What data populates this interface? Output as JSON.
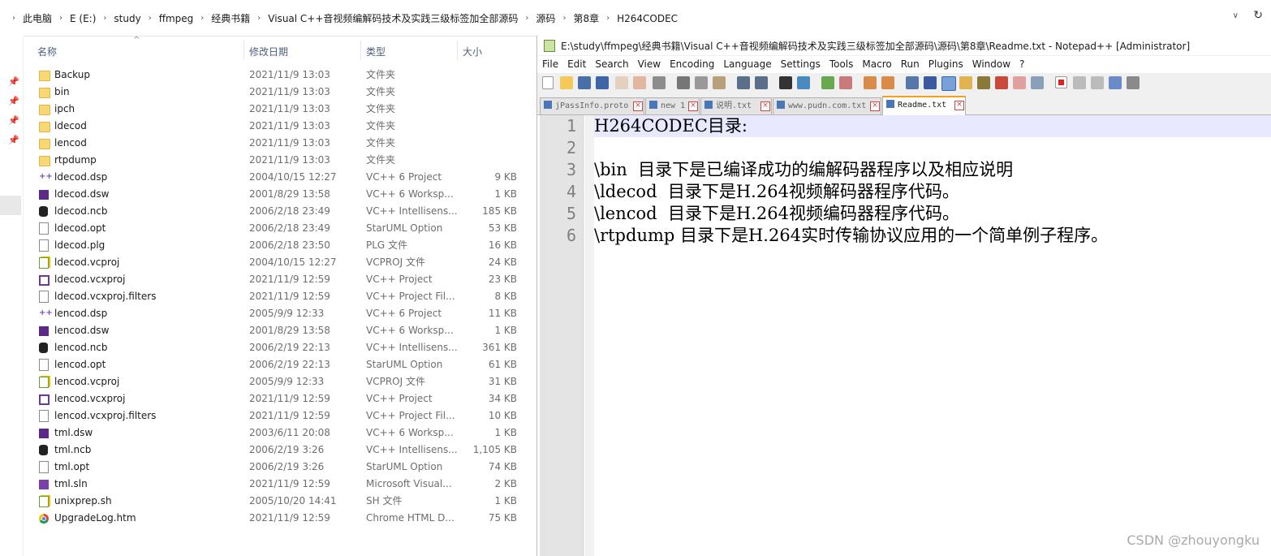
{
  "address_bar": {
    "crumbs": [
      "此电脑",
      "E (E:)",
      "study",
      "ffmpeg",
      "经典书籍",
      "Visual C++音视频编解码技术及实践三级标签加全部源码",
      "源码",
      "第8章",
      "H264CODEC"
    ]
  },
  "columns": {
    "name": "名称",
    "date": "修改日期",
    "type": "类型",
    "size": "大小"
  },
  "files": [
    {
      "icon": "folder-icon",
      "name": "Backup",
      "date": "2021/11/9 13:03",
      "type": "文件夹",
      "size": ""
    },
    {
      "icon": "folder-icon",
      "name": "bin",
      "date": "2021/11/9 13:03",
      "type": "文件夹",
      "size": ""
    },
    {
      "icon": "folder-icon",
      "name": "ipch",
      "date": "2021/11/9 13:03",
      "type": "文件夹",
      "size": ""
    },
    {
      "icon": "folder-icon",
      "name": "ldecod",
      "date": "2021/11/9 13:03",
      "type": "文件夹",
      "size": ""
    },
    {
      "icon": "folder-icon",
      "name": "lencod",
      "date": "2021/11/9 13:03",
      "type": "文件夹",
      "size": ""
    },
    {
      "icon": "folder-icon",
      "name": "rtpdump",
      "date": "2021/11/9 13:03",
      "type": "文件夹",
      "size": ""
    },
    {
      "icon": "cpp-project-icon",
      "name": "ldecod.dsp",
      "date": "2004/10/15 12:27",
      "type": "VC++ 6 Project",
      "size": "9 KB"
    },
    {
      "icon": "vs-workspace-icon",
      "name": "ldecod.dsw",
      "date": "2001/8/29 13:58",
      "type": "VC++ 6 Worksp...",
      "size": "1 KB"
    },
    {
      "icon": "database-icon",
      "name": "ldecod.ncb",
      "date": "2006/2/18 23:49",
      "type": "VC++ Intellisens...",
      "size": "185 KB"
    },
    {
      "icon": "document-icon",
      "name": "ldecod.opt",
      "date": "2006/2/18 23:49",
      "type": "StarUML Option",
      "size": "53 KB"
    },
    {
      "icon": "document-icon",
      "name": "ldecod.plg",
      "date": "2006/2/18 23:50",
      "type": "PLG 文件",
      "size": "16 KB"
    },
    {
      "icon": "edit-document-icon",
      "name": "ldecod.vcproj",
      "date": "2004/10/15 12:27",
      "type": "VCPROJ 文件",
      "size": "24 KB"
    },
    {
      "icon": "vs-project-icon",
      "name": "ldecod.vcxproj",
      "date": "2021/11/9 12:59",
      "type": "VC++ Project",
      "size": "23 KB"
    },
    {
      "icon": "document-icon",
      "name": "ldecod.vcxproj.filters",
      "date": "2021/11/9 12:59",
      "type": "VC++ Project Fil...",
      "size": "8 KB"
    },
    {
      "icon": "cpp-project-icon",
      "name": "lencod.dsp",
      "date": "2005/9/9 12:33",
      "type": "VC++ 6 Project",
      "size": "11 KB"
    },
    {
      "icon": "vs-workspace-icon",
      "name": "lencod.dsw",
      "date": "2001/8/29 13:58",
      "type": "VC++ 6 Worksp...",
      "size": "1 KB"
    },
    {
      "icon": "database-icon",
      "name": "lencod.ncb",
      "date": "2006/2/19 22:13",
      "type": "VC++ Intellisens...",
      "size": "361 KB"
    },
    {
      "icon": "document-icon",
      "name": "lencod.opt",
      "date": "2006/2/19 22:13",
      "type": "StarUML Option",
      "size": "61 KB"
    },
    {
      "icon": "edit-document-icon",
      "name": "lencod.vcproj",
      "date": "2005/9/9 12:33",
      "type": "VCPROJ 文件",
      "size": "31 KB"
    },
    {
      "icon": "vs-project-icon",
      "name": "lencod.vcxproj",
      "date": "2021/11/9 12:59",
      "type": "VC++ Project",
      "size": "34 KB"
    },
    {
      "icon": "document-icon",
      "name": "lencod.vcxproj.filters",
      "date": "2021/11/9 12:59",
      "type": "VC++ Project Fil...",
      "size": "10 KB"
    },
    {
      "icon": "vs-workspace-icon",
      "name": "tml.dsw",
      "date": "2003/6/11 20:08",
      "type": "VC++ 6 Worksp...",
      "size": "1 KB"
    },
    {
      "icon": "database-icon",
      "name": "tml.ncb",
      "date": "2006/2/19 3:26",
      "type": "VC++ Intellisens...",
      "size": "1,105 KB"
    },
    {
      "icon": "document-icon",
      "name": "tml.opt",
      "date": "2006/2/19 3:26",
      "type": "StarUML Option",
      "size": "74 KB"
    },
    {
      "icon": "vs-solution-icon",
      "name": "tml.sln",
      "date": "2021/11/9 12:59",
      "type": "Microsoft Visual...",
      "size": "2 KB"
    },
    {
      "icon": "edit-document-icon",
      "name": "unixprep.sh",
      "date": "2005/10/20 14:41",
      "type": "SH 文件",
      "size": "1 KB"
    },
    {
      "icon": "chrome-icon",
      "name": "UpgradeLog.htm",
      "date": "2021/11/9 12:59",
      "type": "Chrome HTML D...",
      "size": "75 KB"
    }
  ],
  "notepad": {
    "title": "E:\\study\\ffmpeg\\经典书籍\\Visual C++音视频编解码技术及实践三级标签加全部源码\\源码\\第8章\\Readme.txt - Notepad++ [Administrator]",
    "menus": [
      "File",
      "Edit",
      "Search",
      "View",
      "Encoding",
      "Language",
      "Settings",
      "Tools",
      "Macro",
      "Run",
      "Plugins",
      "Window",
      "?"
    ],
    "tabs": [
      {
        "label": "jPassInfo.proto",
        "active": false
      },
      {
        "label": "new 1",
        "active": false
      },
      {
        "label": "说明.txt",
        "active": false
      },
      {
        "label": "www.pudn.com.txt",
        "active": false
      },
      {
        "label": "Readme.txt",
        "active": true
      }
    ],
    "line_numbers": [
      "1",
      "2",
      "3",
      "4",
      "5",
      "6"
    ],
    "lines": [
      "H264CODEC目录:",
      "",
      "\\bin  目录下是已编译成功的编解码器程序以及相应说明",
      "\\ldecod  目录下是H.264视频解码器程序代码。",
      "\\lencod  目录下是H.264视频编码器程序代码。",
      "\\rtpdump 目录下是H.264实时传输协议应用的一个简单例子程序。"
    ]
  },
  "watermark": "CSDN @zhouyongku"
}
